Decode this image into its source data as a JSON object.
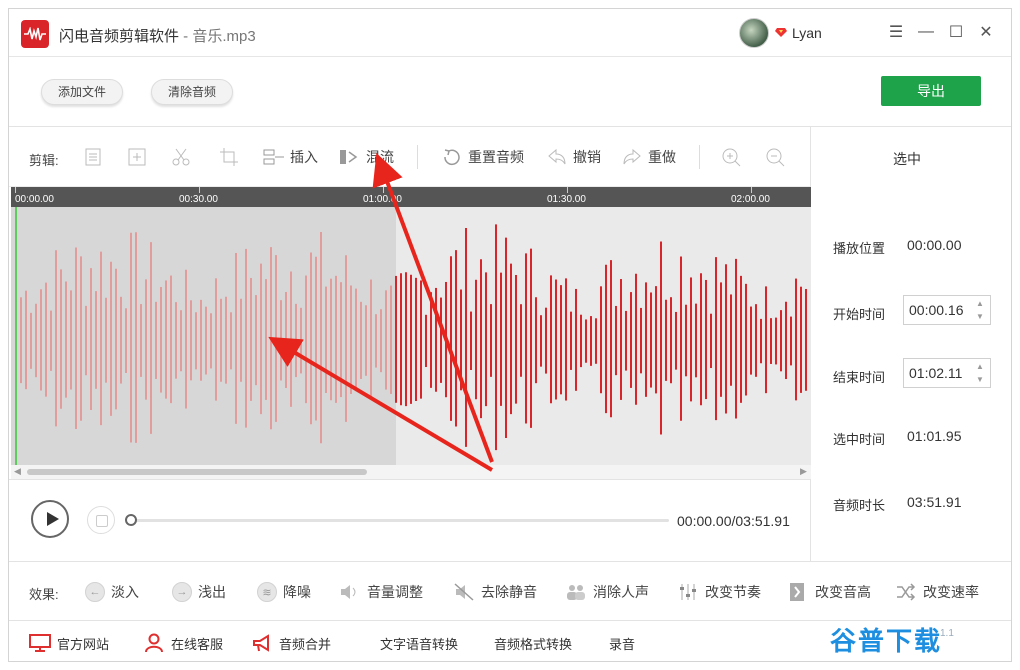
{
  "window": {
    "app_name": "闪电音频剪辑软件",
    "separator": " - ",
    "file_name": "音乐.mp3",
    "user_name": "Lyan"
  },
  "toolbar": {
    "add_file": "添加文件",
    "clear_audio": "清除音频",
    "export": "导出"
  },
  "edit_tools": {
    "label": "剪辑:",
    "insert": "插入",
    "mix": "混流",
    "reset": "重置音频",
    "undo": "撤销",
    "redo": "重做"
  },
  "selection_panel": {
    "header": "选中",
    "play_position_label": "播放位置",
    "play_position_value": "00:00.00",
    "start_label": "开始时间",
    "start_value": "00:00.16",
    "end_label": "结束时间",
    "end_value": "01:02.11",
    "selected_label": "选中时间",
    "selected_value": "01:01.95",
    "duration_label": "音频时长",
    "duration_value": "03:51.91"
  },
  "timeline": {
    "ticks": [
      "00:00.00",
      "00:30.00",
      "01:00.00",
      "01:30.00",
      "02:00.00"
    ]
  },
  "player": {
    "time": "00:00.00/03:51.91",
    "progress": 0
  },
  "effects": {
    "label": "效果:",
    "items": [
      "淡入",
      "浅出",
      "降噪",
      "音量调整",
      "去除静音",
      "消除人声",
      "改变节奏",
      "改变音高",
      "改变速率"
    ]
  },
  "bottom_links": {
    "website": "官方网站",
    "support": "在线客服",
    "merge": "音频合并",
    "tts": "文字语音转换",
    "format": "音频格式转换",
    "record": "录音"
  },
  "watermark": {
    "text": "谷普下载",
    "sub": "1.1"
  },
  "colors": {
    "accent_green": "#1ea24a",
    "wave_red": "#d9252a",
    "wave_selected_red": "#e48e8e",
    "playhead_green": "#5ecb5e",
    "arrow_red": "#e8251c"
  }
}
